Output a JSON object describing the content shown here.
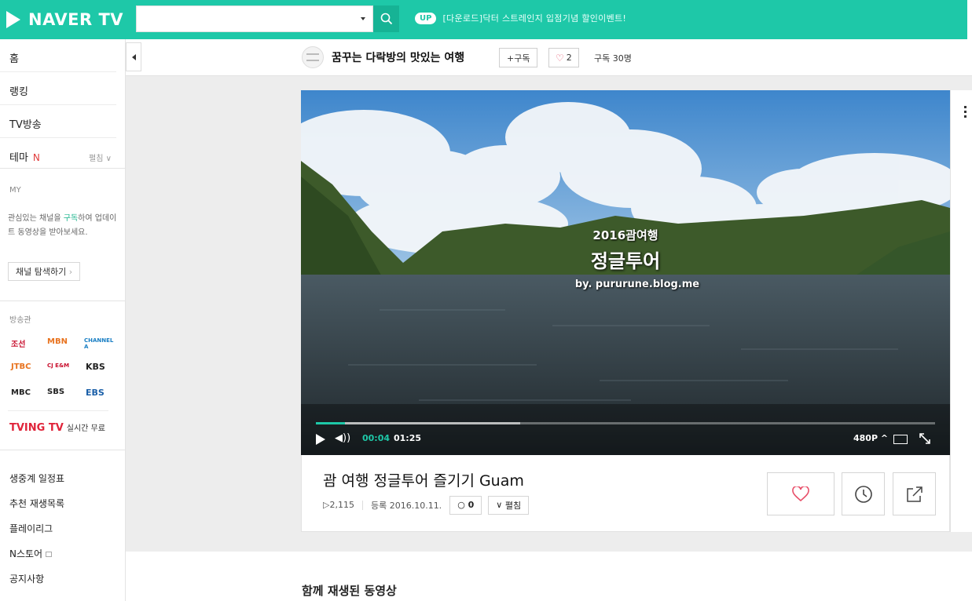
{
  "header": {
    "logo_text": "NAVER TV",
    "search_value": "",
    "promo_badge": "UP",
    "promo_text": "[다운로드]닥터 스트레인지 입점기념 할인이벤트!"
  },
  "sidebar": {
    "nav": [
      {
        "label": "홈"
      },
      {
        "label": "랭킹"
      },
      {
        "label": "TV방송"
      },
      {
        "label": "테마",
        "badge": "N",
        "action": "펼침"
      }
    ],
    "my_label": "MY",
    "my_desc_before": "관심있는 채널을 ",
    "my_desc_highlight": "구독",
    "my_desc_after": "하여 업데이트 동영상을 받아보세요.",
    "explore_button": "채널 탐색하기",
    "broadcast_label": "방송관",
    "broadcasters": [
      "조선",
      "MBN",
      "CHANNEL A",
      "JTBC",
      "CJ E&M",
      "KBS",
      "MBC",
      "SBS",
      "EBS"
    ],
    "tving_logo": "TVING TV",
    "tving_text": "실시간 무료",
    "bottom_links": [
      "생중계 일정표",
      "추천 재생목록",
      "플레이리그",
      "N스토어",
      "공지사항"
    ]
  },
  "channel": {
    "name": "꿈꾸는 다락방의 맛있는 여행",
    "subscribe_label": "+구독",
    "likes": "2",
    "subscriber_text": "구독 30명"
  },
  "player": {
    "overlay_line1": "2016괌여행",
    "overlay_line2": "정글투어",
    "overlay_line3": "by. pururune.blog.me",
    "current_time": "00:04",
    "total_time": "01:25",
    "progress_fraction": 0.047,
    "buffer_fraction": 0.33,
    "quality": "480P"
  },
  "video": {
    "title": "괌 여행 정글투어 즐기기 Guam",
    "views": "2,115",
    "registered": "등록 2016.10.11.",
    "comments": "0",
    "expand_label": "펼침"
  },
  "related_title": "함께 재생된 동영상",
  "colors": {
    "accent": "#1ec8a8",
    "heart": "#e8506a",
    "new_badge": "#e03b3b",
    "tving": "#e0243a"
  }
}
